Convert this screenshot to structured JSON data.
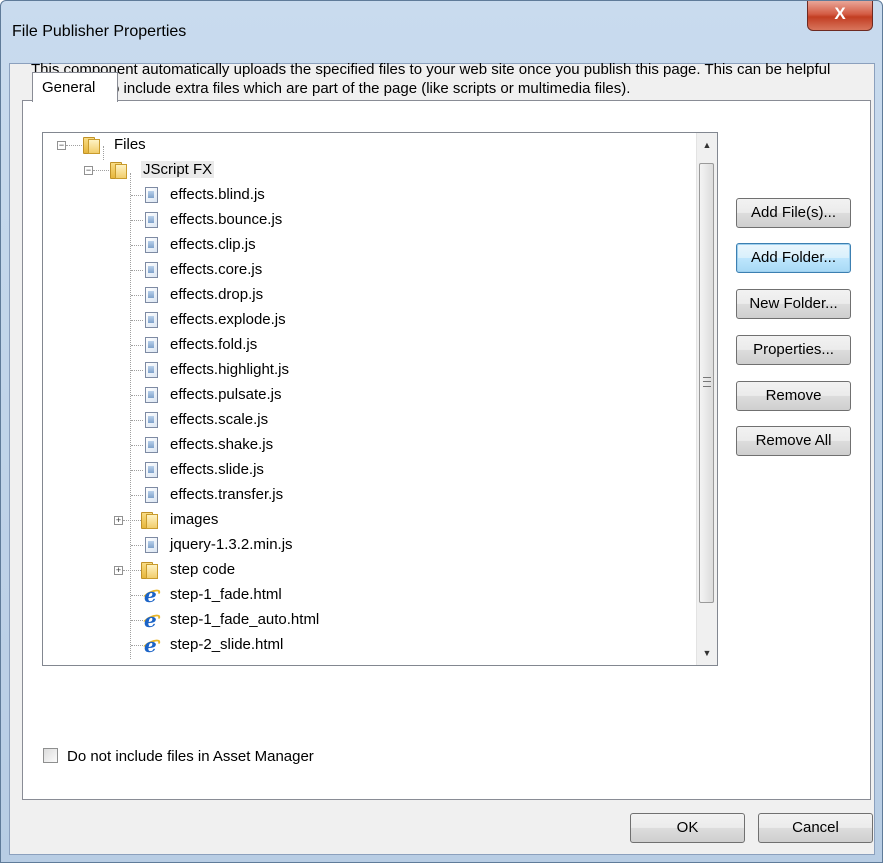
{
  "window": {
    "title": "File Publisher Properties",
    "close_symbol": "X"
  },
  "tabs": [
    {
      "label": "General"
    }
  ],
  "description": "This component automatically uploads the specified files to your web site once you publish this page. This can be helpful if you want to include extra files which are part of the page (like scripts or multimedia files).",
  "tree": {
    "root": "Files",
    "folder": "JScript FX",
    "files": [
      "effects.blind.js",
      "effects.bounce.js",
      "effects.clip.js",
      "effects.core.js",
      "effects.drop.js",
      "effects.explode.js",
      "effects.fold.js",
      "effects.highlight.js",
      "effects.pulsate.js",
      "effects.scale.js",
      "effects.shake.js",
      "effects.slide.js",
      "effects.transfer.js"
    ],
    "images_folder": "images",
    "jquery_file": "jquery-1.3.2.min.js",
    "step_folder": "step code",
    "html_files": [
      "step-1_fade.html",
      "step-1_fade_auto.html",
      "step-2_slide.html"
    ]
  },
  "buttons": {
    "add_files": "Add File(s)...",
    "add_folder": "Add Folder...",
    "new_folder": "New Folder...",
    "properties": "Properties...",
    "remove": "Remove",
    "remove_all": "Remove All",
    "ok": "OK",
    "cancel": "Cancel"
  },
  "checkbox": {
    "label": "Do not include files in Asset Manager",
    "checked": false
  },
  "scrollbar": {
    "up": "▲",
    "down": "▼"
  }
}
